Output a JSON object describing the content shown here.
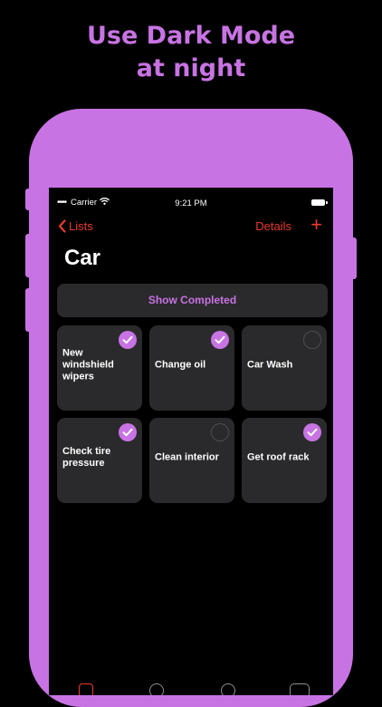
{
  "promo": {
    "line1": "Use Dark Mode",
    "line2": "at night"
  },
  "status_bar": {
    "carrier": "Carrier",
    "time": "9:21 PM"
  },
  "nav": {
    "back_label": "Lists",
    "details_label": "Details",
    "add_label": "+"
  },
  "title": "Car",
  "show_completed_label": "Show Completed",
  "items": [
    {
      "label": "New windshield wipers",
      "completed": true
    },
    {
      "label": "Change oil",
      "completed": true
    },
    {
      "label": "Car Wash",
      "completed": false
    },
    {
      "label": "Check tire pressure",
      "completed": true
    },
    {
      "label": "Clean interior",
      "completed": false
    },
    {
      "label": "Get roof rack",
      "completed": true
    }
  ],
  "colors": {
    "accent": "#c873e3",
    "nav_red": "#ea3a2f",
    "card_bg": "#2a2a2c"
  }
}
